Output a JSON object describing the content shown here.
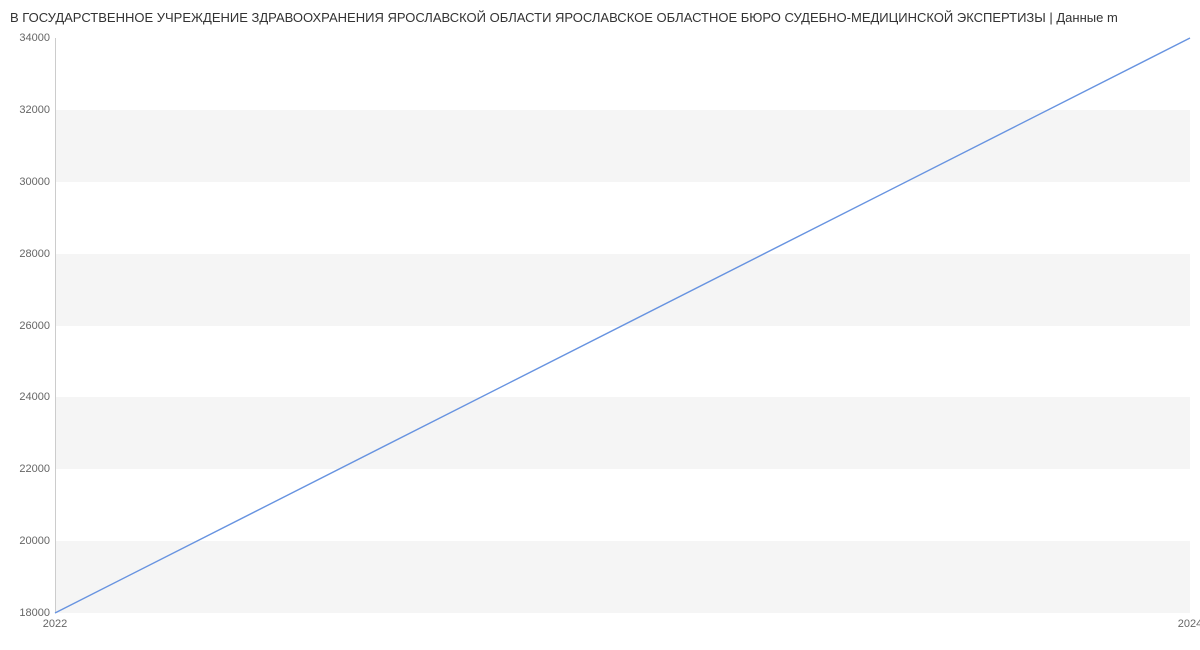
{
  "title": "В ГОСУДАРСТВЕННОЕ УЧРЕЖДЕНИЕ ЗДРАВООХРАНЕНИЯ ЯРОСЛАВСКОЙ ОБЛАСТИ ЯРОСЛАВСКОЕ ОБЛАСТНОЕ БЮРО СУДЕБНО-МЕДИЦИНСКОЙ ЭКСПЕРТИЗЫ | Данные m",
  "chart_data": {
    "type": "line",
    "x": [
      2022,
      2024
    ],
    "values": [
      18000,
      34000
    ],
    "title": "В ГОСУДАРСТВЕННОЕ УЧРЕЖДЕНИЕ ЗДРАВООХРАНЕНИЯ ЯРОСЛАВСКОЙ ОБЛАСТИ ЯРОСЛАВСКОЕ ОБЛАСТНОЕ БЮРО СУДЕБНО-МЕДИЦИНСКОЙ ЭКСПЕРТИЗЫ | Данные m",
    "xlabel": "",
    "ylabel": "",
    "xlim": [
      2022,
      2024
    ],
    "ylim": [
      18000,
      34000
    ],
    "y_ticks": [
      18000,
      20000,
      22000,
      24000,
      26000,
      28000,
      30000,
      32000,
      34000
    ],
    "x_ticks": [
      2022,
      2024
    ],
    "line_color": "#6793e0",
    "grid": "banded"
  }
}
